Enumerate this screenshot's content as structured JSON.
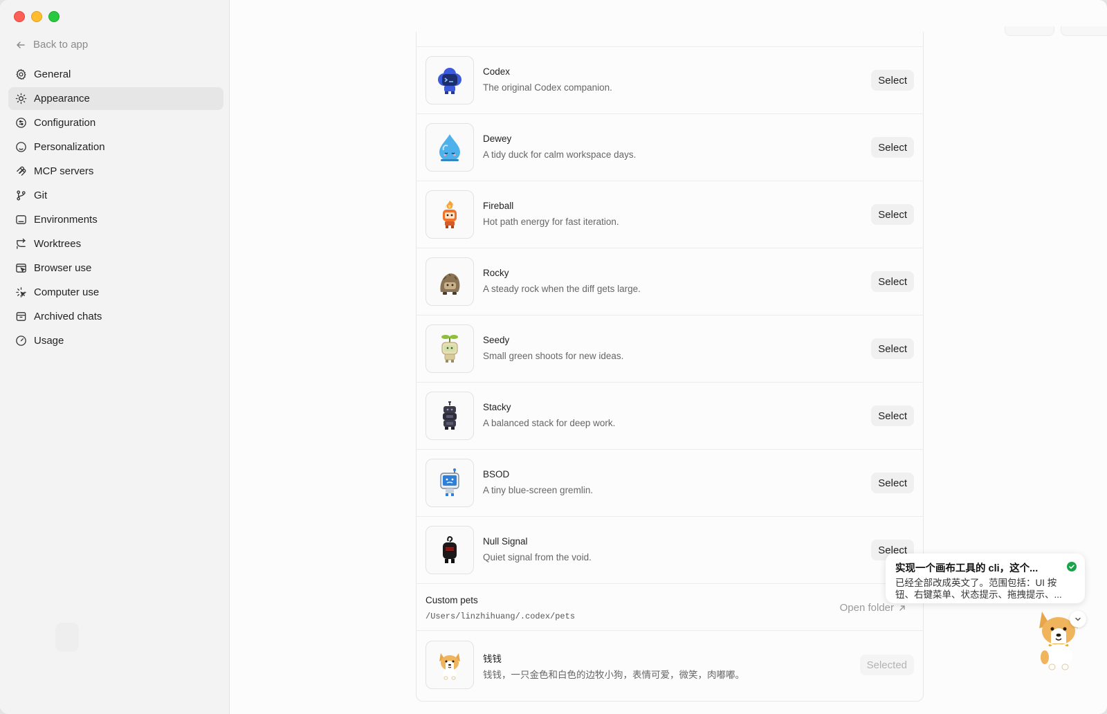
{
  "sidebar": {
    "back_label": "Back to app",
    "items": [
      {
        "label": "General",
        "icon": "gear-icon"
      },
      {
        "label": "Appearance",
        "icon": "sun-icon",
        "active": true
      },
      {
        "label": "Configuration",
        "icon": "sliders-icon"
      },
      {
        "label": "Personalization",
        "icon": "user-circle-icon"
      },
      {
        "label": "MCP servers",
        "icon": "mcp-icon"
      },
      {
        "label": "Git",
        "icon": "git-branch-icon"
      },
      {
        "label": "Environments",
        "icon": "terminal-box-icon"
      },
      {
        "label": "Worktrees",
        "icon": "worktree-icon"
      },
      {
        "label": "Browser use",
        "icon": "browser-icon"
      },
      {
        "label": "Computer use",
        "icon": "cursor-sparkle-icon"
      },
      {
        "label": "Archived chats",
        "icon": "archive-icon"
      },
      {
        "label": "Usage",
        "icon": "gauge-icon"
      }
    ]
  },
  "pets": [
    {
      "name": "Codex",
      "description": "The original Codex companion.",
      "action": "Select",
      "icon": "codex-robot-icon",
      "color": "#3b5bdb"
    },
    {
      "name": "Dewey",
      "description": "A tidy duck for calm workspace days.",
      "action": "Select",
      "icon": "water-drop-icon",
      "color": "#4db2ec"
    },
    {
      "name": "Fireball",
      "description": "Hot path energy for fast iteration.",
      "action": "Select",
      "icon": "fireball-icon",
      "color": "#f0732c"
    },
    {
      "name": "Rocky",
      "description": "A steady rock when the diff gets large.",
      "action": "Select",
      "icon": "rock-icon",
      "color": "#8b7355"
    },
    {
      "name": "Seedy",
      "description": "Small green shoots for new ideas.",
      "action": "Select",
      "icon": "sprout-icon",
      "color": "#b5c98a"
    },
    {
      "name": "Stacky",
      "description": "A balanced stack for deep work.",
      "action": "Select",
      "icon": "stack-robot-icon",
      "color": "#3a3a4a"
    },
    {
      "name": "BSOD",
      "description": "A tiny blue-screen gremlin.",
      "action": "Select",
      "icon": "bsod-monitor-icon",
      "color": "#2f7fd8"
    },
    {
      "name": "Null Signal",
      "description": "Quiet signal from the void.",
      "action": "Select",
      "icon": "null-signal-icon",
      "color": "#1a1a1a"
    }
  ],
  "custom_pets": {
    "title": "Custom pets",
    "path": "/Users/linzhihuang/.codex/pets",
    "open_folder_label": "Open folder"
  },
  "custom_pet": {
    "name": "钱钱",
    "description": "钱钱，一只金色和白色的边牧小狗，表情可爱，微笑，肉嘟嘟。",
    "action": "Selected",
    "icon": "corgi-icon"
  },
  "toast": {
    "title": "实现一个画布工具的 cli，这个...",
    "body": "已经全部改成英文了。范围包括：UI 按钮、右键菜单、状态提示、拖拽提示、..."
  }
}
